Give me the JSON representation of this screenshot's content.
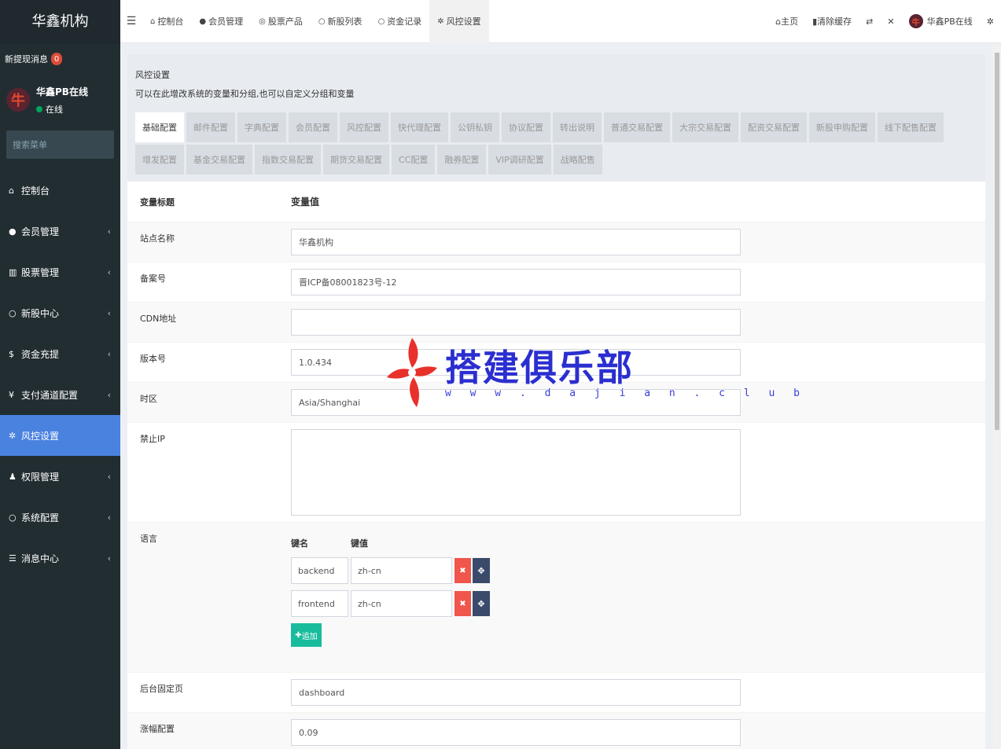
{
  "sidebar": {
    "brand": "华鑫机构",
    "notice_label": "新提现消息",
    "notice_count": "0",
    "user_name": "华鑫PB在线",
    "user_status": "在线",
    "search_placeholder": "搜索菜单",
    "items": [
      {
        "label": "控制台",
        "icon": "dashboard-icon",
        "chev": ""
      },
      {
        "label": "会员管理",
        "icon": "user-icon",
        "chev": "‹"
      },
      {
        "label": "股票管理",
        "icon": "bank-icon",
        "chev": "‹"
      },
      {
        "label": "新股中心",
        "icon": "circle-icon",
        "chev": "‹"
      },
      {
        "label": "资金充提",
        "icon": "dollar-icon",
        "chev": "‹"
      },
      {
        "label": "支付通道配置",
        "icon": "yen-icon",
        "chev": "‹"
      },
      {
        "label": "风控设置",
        "icon": "gear-icon",
        "chev": ""
      },
      {
        "label": "权限管理",
        "icon": "group-icon",
        "chev": "‹"
      },
      {
        "label": "系统配置",
        "icon": "circle-icon",
        "chev": "‹"
      },
      {
        "label": "消息中心",
        "icon": "list-icon",
        "chev": "‹"
      }
    ]
  },
  "topnav": {
    "tabs": [
      {
        "label": "控制台",
        "icon": "dashboard-icon"
      },
      {
        "label": "会员管理",
        "icon": "user-icon"
      },
      {
        "label": "股票产品",
        "icon": "target-icon"
      },
      {
        "label": "新股列表",
        "icon": "circle-icon"
      },
      {
        "label": "资金记录",
        "icon": "circle-icon"
      },
      {
        "label": "风控设置",
        "icon": "gear-icon"
      }
    ],
    "home": "主页",
    "clear_cache": "清除缓存",
    "user": "华鑫PB在线"
  },
  "panel": {
    "title": "风控设置",
    "desc": "可以在此增改系统的变量和分组,也可以自定义分组和变量",
    "tabs": [
      "基础配置",
      "邮件配置",
      "字典配置",
      "会员配置",
      "风控配置",
      "快代理配置",
      "公钥私钥",
      "协议配置",
      "转出说明",
      "普通交易配置",
      "大宗交易配置",
      "配资交易配置",
      "新股申购配置",
      "线下配售配置",
      "增发配置",
      "基金交易配置",
      "指数交易配置",
      "期货交易配置",
      "CC配置",
      "融券配置",
      "VIP调研配置",
      "战略配售"
    ]
  },
  "form": {
    "col_title": "变量标题",
    "col_value": "变量值",
    "site_name_label": "站点名称",
    "site_name": "华鑫机构",
    "beian_label": "备案号",
    "beian": "晋ICP备08001823号-12",
    "cdn_label": "CDN地址",
    "cdn": "",
    "version_label": "版本号",
    "version": "1.0.434",
    "timezone_label": "时区",
    "timezone": "Asia/Shanghai",
    "forbid_ip_label": "禁止IP",
    "lang_label": "语言",
    "key_name": "键名",
    "key_value": "键值",
    "langs": [
      {
        "k": "backend",
        "v": "zh-cn"
      },
      {
        "k": "frontend",
        "v": "zh-cn"
      }
    ],
    "add_label": "追加",
    "fixed_page_label": "后台固定页",
    "fixed_page": "dashboard",
    "rise_label": "涨幅配置",
    "rise": "0.09"
  },
  "watermark": {
    "title": "搭建俱乐部",
    "url": "w w w . d a j i a n . c l u b"
  }
}
